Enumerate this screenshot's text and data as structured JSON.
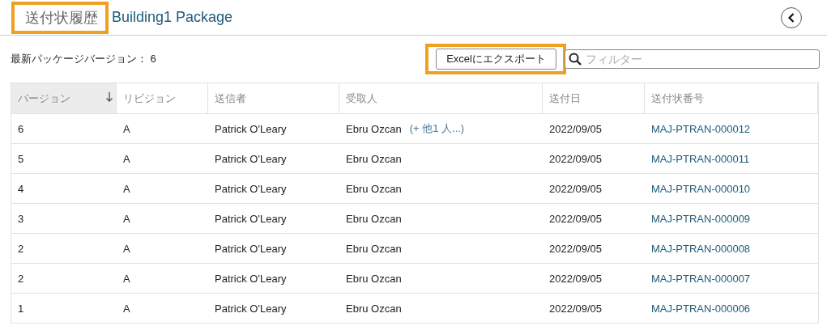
{
  "header": {
    "title": "送付状履歴",
    "title_highlighted": true,
    "package": "Building1 Package"
  },
  "toolbar": {
    "latest_label": "最新パッケージバージョン： 6",
    "export_button": "Excelにエクスポート",
    "export_highlighted": true,
    "filter": {
      "placeholder": "フィルター"
    }
  },
  "table": {
    "columns": [
      {
        "label": "バージョン",
        "sorted": true
      },
      {
        "label": "リビジョン",
        "sorted": false
      },
      {
        "label": "送信者",
        "sorted": false
      },
      {
        "label": "受取人",
        "sorted": false
      },
      {
        "label": "送付日",
        "sorted": false
      },
      {
        "label": "送付状番号",
        "sorted": false
      }
    ],
    "rows": [
      {
        "version": "6",
        "revision": "A",
        "sender": "Patrick O'Leary",
        "recipient": "Ebru Ozcan",
        "more": "(+ 他1 人...)",
        "date": "2022/09/05",
        "number": "MAJ-PTRAN-000012"
      },
      {
        "version": "5",
        "revision": "A",
        "sender": "Patrick O'Leary",
        "recipient": "Ebru Ozcan",
        "date": "2022/09/05",
        "number": "MAJ-PTRAN-000011"
      },
      {
        "version": "4",
        "revision": "A",
        "sender": "Patrick O'Leary",
        "recipient": "Ebru Ozcan",
        "date": "2022/09/05",
        "number": "MAJ-PTRAN-000010"
      },
      {
        "version": "3",
        "revision": "A",
        "sender": "Patrick O'Leary",
        "recipient": "Ebru Ozcan",
        "date": "2022/09/05",
        "number": "MAJ-PTRAN-000009"
      },
      {
        "version": "2",
        "revision": "A",
        "sender": "Patrick O'Leary",
        "recipient": "Ebru Ozcan",
        "date": "2022/09/05",
        "number": "MAJ-PTRAN-000008"
      },
      {
        "version": "2",
        "revision": "A",
        "sender": "Patrick O'Leary",
        "recipient": "Ebru Ozcan",
        "date": "2022/09/05",
        "number": "MAJ-PTRAN-000007"
      },
      {
        "version": "1",
        "revision": "A",
        "sender": "Patrick O'Leary",
        "recipient": "Ebru Ozcan",
        "date": "2022/09/05",
        "number": "MAJ-PTRAN-000006"
      }
    ]
  }
}
